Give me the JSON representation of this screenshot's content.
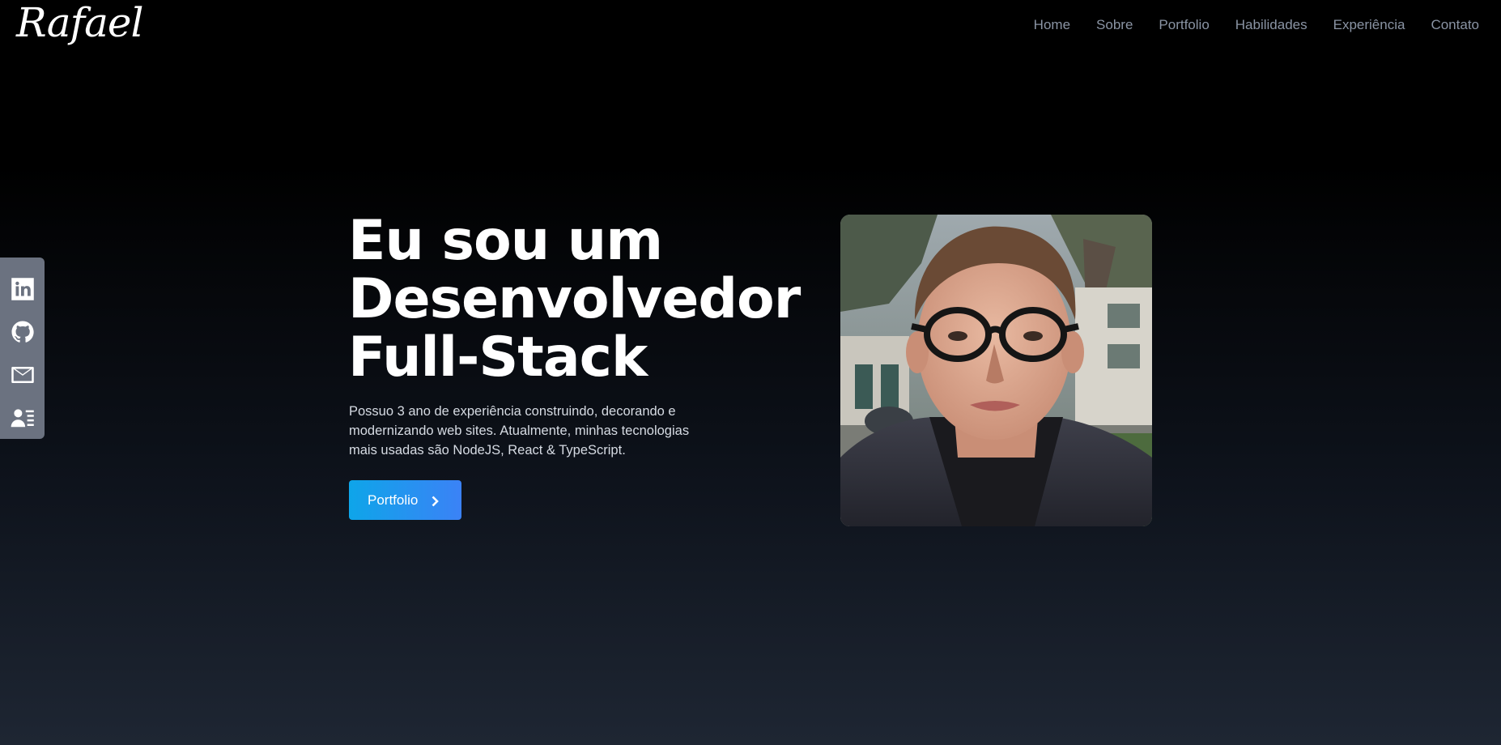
{
  "header": {
    "logo": "Rafael",
    "nav": [
      "Home",
      "Sobre",
      "Portfolio",
      "Habilidades",
      "Experiência",
      "Contato"
    ]
  },
  "social": [
    {
      "icon": "linkedin-icon"
    },
    {
      "icon": "github-icon"
    },
    {
      "icon": "mail-icon"
    },
    {
      "icon": "resume-icon"
    }
  ],
  "hero": {
    "title_lines": [
      "Eu sou um",
      "Desenvolvedor",
      "Full-Stack"
    ],
    "description": "Possuo 3 ano de experiência construindo, decorando e modernizando web sites. Atualmente, minhas tecnologias mais usadas são NodeJS, React & TypeScript.",
    "button_label": "Portfolio"
  },
  "colors": {
    "accent_start": "#0ea5e9",
    "accent_end": "#3b82f6",
    "nav_text": "#8a94a4",
    "sidebar_bg": "#6b7280"
  }
}
